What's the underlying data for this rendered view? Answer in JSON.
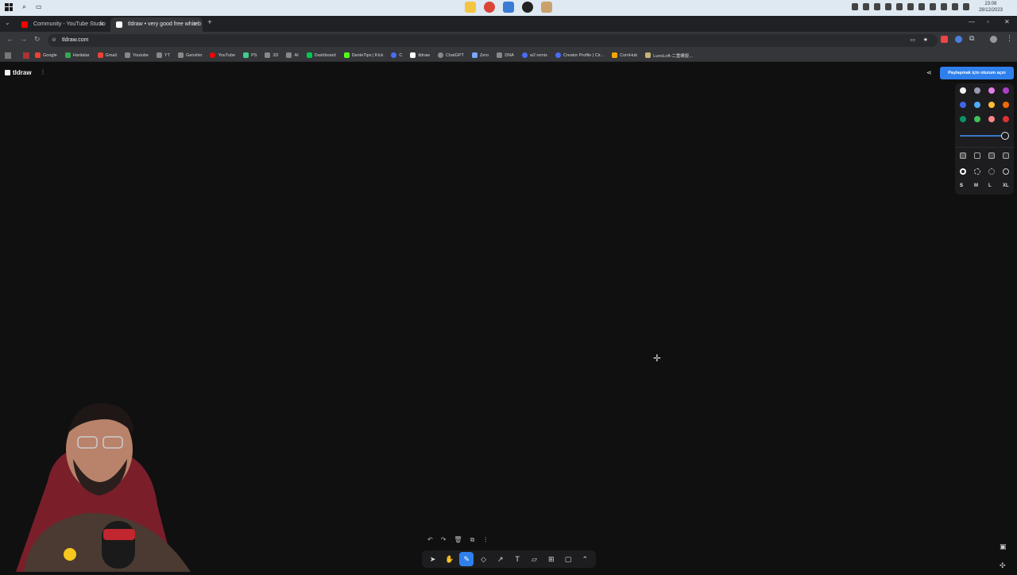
{
  "taskbar": {
    "time": "23:06",
    "date": "28/12/2023"
  },
  "tabs": [
    {
      "title": "Community - YouTube Studio",
      "favicon_color": "#ff0000"
    },
    {
      "title": "tldraw • very good free whiteb",
      "favicon_color": "#ffffff"
    }
  ],
  "address": {
    "url": "tldraw.com"
  },
  "bookmarks": [
    {
      "label": "Google",
      "color": "#ea4335"
    },
    {
      "label": "Haritalar",
      "color": "#34a853"
    },
    {
      "label": "Gmail",
      "color": "#ea4335"
    },
    {
      "label": "Youtube",
      "color": "#9aa0a6"
    },
    {
      "label": "YT",
      "color": "#9aa0a6"
    },
    {
      "label": "Genshin",
      "color": "#9aa0a6"
    },
    {
      "label": "YouTube",
      "color": "#ff0000"
    },
    {
      "label": "PS",
      "color": "#3ecf8e"
    },
    {
      "label": "3D",
      "color": "#9aa0a6"
    },
    {
      "label": "AI",
      "color": "#9aa0a6"
    },
    {
      "label": "Dashboard",
      "color": "#00c853"
    },
    {
      "label": "DanteTips | Kick",
      "color": "#53fc18"
    },
    {
      "label": "C",
      "color": "#4a6cf7"
    },
    {
      "label": "tldraw",
      "color": "#ffffff"
    },
    {
      "label": "ChatGPT",
      "color": "#9aa0a6"
    },
    {
      "label": "Zero",
      "color": "#7aa7ff"
    },
    {
      "label": "DNA",
      "color": "#9aa0a6"
    },
    {
      "label": "w2 remix",
      "color": "#4a6cf7"
    },
    {
      "label": "Creator Profile | Cir...",
      "color": "#4a6cf7"
    },
    {
      "label": "CornHub",
      "color": "#f7a600"
    },
    {
      "label": "LunoLoft-二重螺旋...",
      "color": "#c8b27a"
    }
  ],
  "app": {
    "logo": "tldraw",
    "signin_label": "Paylaşmak için oturum açın"
  },
  "style_panel": {
    "colors": [
      "#f2f2f2",
      "#9a9ab0",
      "#e57ee5",
      "#ae3ec9",
      "#4263eb",
      "#4dabf7",
      "#ffc034",
      "#f76707",
      "#099268",
      "#40c057",
      "#ff8787",
      "#e03131"
    ],
    "opacity": 1.0,
    "sizes": [
      "S",
      "M",
      "L",
      "XL"
    ],
    "selected_size": "S"
  },
  "toolbar": {
    "tools": [
      "select",
      "hand",
      "draw",
      "eraser",
      "arrow",
      "text",
      "note",
      "frame",
      "rectangle",
      "more"
    ],
    "active": "draw"
  }
}
